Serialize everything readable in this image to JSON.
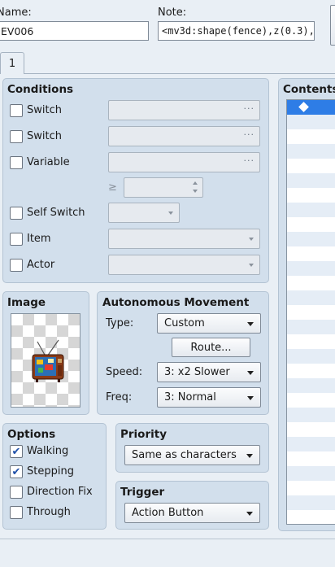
{
  "header": {
    "name_label": "Name:",
    "name_value": "EV006",
    "note_label": "Note:",
    "note_value": "<mv3d:shape(fence),z(0.3),"
  },
  "tabs": [
    "1"
  ],
  "conditions": {
    "title": "Conditions",
    "switch1": "Switch",
    "switch2": "Switch",
    "variable": "Variable",
    "gte": "≥",
    "self_switch": "Self Switch",
    "item": "Item",
    "actor": "Actor"
  },
  "image": {
    "title": "Image",
    "graphic": "tv-sprite"
  },
  "autonomous": {
    "title": "Autonomous Movement",
    "type_label": "Type:",
    "type_value": "Custom",
    "route_button": "Route...",
    "speed_label": "Speed:",
    "speed_value": "3: x2 Slower",
    "freq_label": "Freq:",
    "freq_value": "3: Normal"
  },
  "options": {
    "title": "Options",
    "walking": "Walking",
    "walking_checked": true,
    "stepping": "Stepping",
    "stepping_checked": true,
    "direction_fix": "Direction Fix",
    "direction_fix_checked": false,
    "through": "Through",
    "through_checked": false
  },
  "priority": {
    "title": "Priority",
    "value": "Same as characters"
  },
  "trigger": {
    "title": "Trigger",
    "value": "Action Button"
  },
  "contents": {
    "title": "Contents",
    "first_item_icon": "diamond-icon"
  },
  "colors": {
    "background": "#e9eff5",
    "panel": "#d2dfec",
    "selection": "#2e7de6"
  }
}
